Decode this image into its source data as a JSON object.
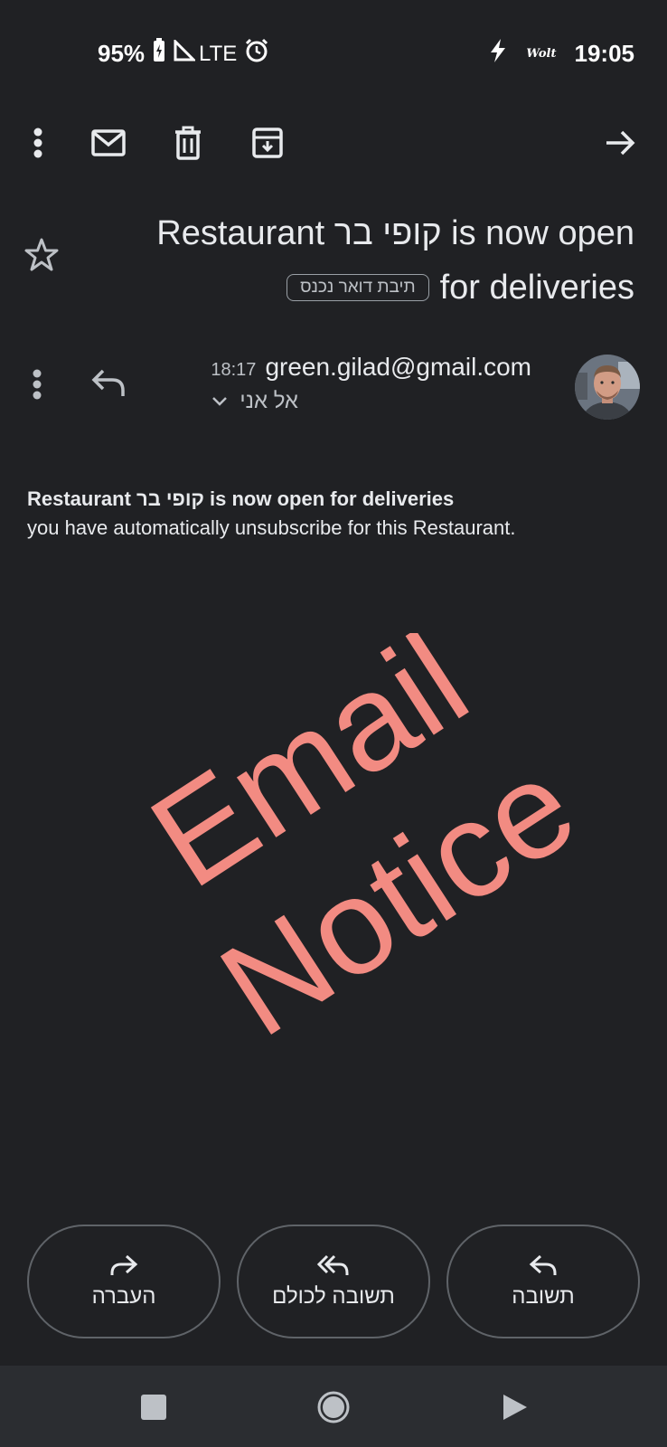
{
  "status_bar": {
    "battery": "95%",
    "network": "LTE",
    "app_badge": "Wolt",
    "time": "19:05"
  },
  "toolbar": {
    "icons": [
      "more-icon",
      "mark-unread-icon",
      "delete-icon",
      "archive-icon",
      "forward-arrow-icon"
    ]
  },
  "email": {
    "subject_line1": "Restaurant קופי בר is now open",
    "subject_line2": "for deliveries",
    "label": "תיבת דואר נכנס",
    "sender": "green.gilad@gmail.com",
    "time": "18:17",
    "to": "אל אני",
    "body_bold": "Restaurant קופי בר is now open for deliveries",
    "body_text": "you have automatically unsubscribe for this Restaurant.",
    "watermark_line1": "Email",
    "watermark_line2": "Notice",
    "watermark_color": "#f28b82"
  },
  "actions": {
    "forward": "העברה",
    "reply_all": "תשובה לכולם",
    "reply": "תשובה"
  },
  "colors": {
    "background": "#202124",
    "text": "#e8eaed",
    "muted": "#bdc1c6",
    "border": "#5f6368"
  }
}
